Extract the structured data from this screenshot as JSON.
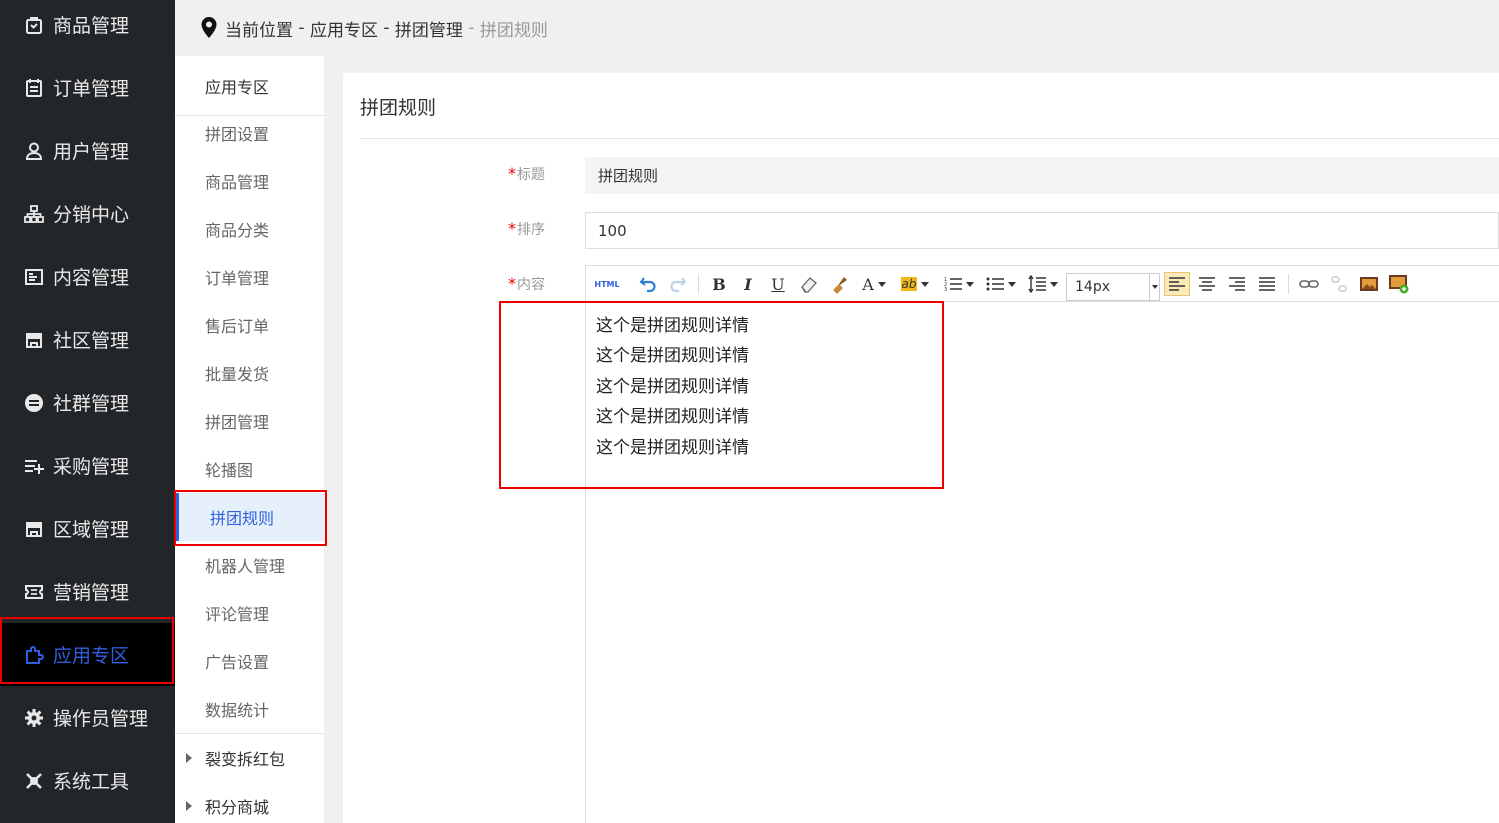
{
  "sidebar": {
    "items": [
      {
        "label": "商品管理",
        "icon": "shopping-bag-icon"
      },
      {
        "label": "订单管理",
        "icon": "clipboard-icon"
      },
      {
        "label": "用户管理",
        "icon": "user-icon"
      },
      {
        "label": "分销中心",
        "icon": "org-tree-icon"
      },
      {
        "label": "内容管理",
        "icon": "document-icon"
      },
      {
        "label": "社区管理",
        "icon": "store-icon"
      },
      {
        "label": "社群管理",
        "icon": "group-icon"
      },
      {
        "label": "采购管理",
        "icon": "list-add-icon"
      },
      {
        "label": "区域管理",
        "icon": "store-icon"
      },
      {
        "label": "营销管理",
        "icon": "ticket-icon"
      },
      {
        "label": "应用专区",
        "icon": "puzzle-icon",
        "active": true
      },
      {
        "label": "操作员管理",
        "icon": "gear-icon"
      },
      {
        "label": "系统工具",
        "icon": "tools-icon"
      }
    ]
  },
  "header": {
    "crumbs": [
      "当前位置",
      "应用专区",
      "拼团管理",
      "拼团规则"
    ],
    "separator": " - "
  },
  "submenu": {
    "title": "应用专区",
    "items": [
      "拼团设置",
      "商品管理",
      "商品分类",
      "订单管理",
      "售后订单",
      "批量发货",
      "拼团管理",
      "轮播图",
      "拼团规则",
      "机器人管理",
      "评论管理",
      "广告设置",
      "数据统计"
    ],
    "active": "拼团规则",
    "groups": [
      "裂变拆红包",
      "积分商城"
    ]
  },
  "main": {
    "title": "拼团规则",
    "form": {
      "title_label": "标题",
      "title_value": "拼团规则",
      "sort_label": "排序",
      "sort_value": "100",
      "content_label": "内容"
    },
    "editor": {
      "font_size": "14px",
      "html_label": "HTML",
      "content_lines": [
        "这个是拼团规则详情",
        "这个是拼团规则详情",
        "这个是拼团规则详情",
        "这个是拼团规则详情",
        "这个是拼团规则详情"
      ]
    }
  },
  "colors": {
    "sidebar_bg": "#232629",
    "accent": "#2f5fe0",
    "highlight_border": "#e00000"
  }
}
